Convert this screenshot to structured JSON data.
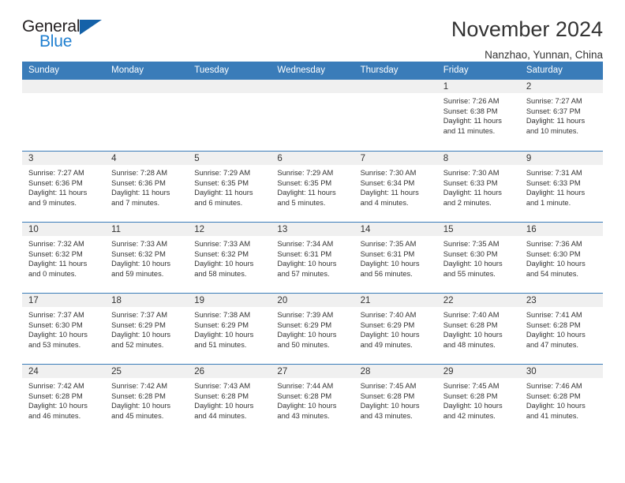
{
  "brand": {
    "name_part1": "General",
    "name_part2": "Blue",
    "triangle_color": "#1461a8",
    "blue_text_color": "#1f7fd0"
  },
  "header": {
    "title": "November 2024",
    "subtitle": "Nanzhao, Yunnan, China"
  },
  "theme": {
    "header_blue": "#3a7cb9",
    "daynum_band": "#f0f0f0",
    "text": "#333333"
  },
  "weekday_headers": [
    "Sunday",
    "Monday",
    "Tuesday",
    "Wednesday",
    "Thursday",
    "Friday",
    "Saturday"
  ],
  "weeks": [
    [
      {
        "day": "",
        "empty": true,
        "sunrise": "",
        "sunset": "",
        "daylight_line1": "",
        "daylight_line2": ""
      },
      {
        "day": "",
        "empty": true,
        "sunrise": "",
        "sunset": "",
        "daylight_line1": "",
        "daylight_line2": ""
      },
      {
        "day": "",
        "empty": true,
        "sunrise": "",
        "sunset": "",
        "daylight_line1": "",
        "daylight_line2": ""
      },
      {
        "day": "",
        "empty": true,
        "sunrise": "",
        "sunset": "",
        "daylight_line1": "",
        "daylight_line2": ""
      },
      {
        "day": "",
        "empty": true,
        "sunrise": "",
        "sunset": "",
        "daylight_line1": "",
        "daylight_line2": ""
      },
      {
        "day": "1",
        "empty": false,
        "sunrise": "Sunrise: 7:26 AM",
        "sunset": "Sunset: 6:38 PM",
        "daylight_line1": "Daylight: 11 hours",
        "daylight_line2": "and 11 minutes."
      },
      {
        "day": "2",
        "empty": false,
        "sunrise": "Sunrise: 7:27 AM",
        "sunset": "Sunset: 6:37 PM",
        "daylight_line1": "Daylight: 11 hours",
        "daylight_line2": "and 10 minutes."
      }
    ],
    [
      {
        "day": "3",
        "empty": false,
        "sunrise": "Sunrise: 7:27 AM",
        "sunset": "Sunset: 6:36 PM",
        "daylight_line1": "Daylight: 11 hours",
        "daylight_line2": "and 9 minutes."
      },
      {
        "day": "4",
        "empty": false,
        "sunrise": "Sunrise: 7:28 AM",
        "sunset": "Sunset: 6:36 PM",
        "daylight_line1": "Daylight: 11 hours",
        "daylight_line2": "and 7 minutes."
      },
      {
        "day": "5",
        "empty": false,
        "sunrise": "Sunrise: 7:29 AM",
        "sunset": "Sunset: 6:35 PM",
        "daylight_line1": "Daylight: 11 hours",
        "daylight_line2": "and 6 minutes."
      },
      {
        "day": "6",
        "empty": false,
        "sunrise": "Sunrise: 7:29 AM",
        "sunset": "Sunset: 6:35 PM",
        "daylight_line1": "Daylight: 11 hours",
        "daylight_line2": "and 5 minutes."
      },
      {
        "day": "7",
        "empty": false,
        "sunrise": "Sunrise: 7:30 AM",
        "sunset": "Sunset: 6:34 PM",
        "daylight_line1": "Daylight: 11 hours",
        "daylight_line2": "and 4 minutes."
      },
      {
        "day": "8",
        "empty": false,
        "sunrise": "Sunrise: 7:30 AM",
        "sunset": "Sunset: 6:33 PM",
        "daylight_line1": "Daylight: 11 hours",
        "daylight_line2": "and 2 minutes."
      },
      {
        "day": "9",
        "empty": false,
        "sunrise": "Sunrise: 7:31 AM",
        "sunset": "Sunset: 6:33 PM",
        "daylight_line1": "Daylight: 11 hours",
        "daylight_line2": "and 1 minute."
      }
    ],
    [
      {
        "day": "10",
        "empty": false,
        "sunrise": "Sunrise: 7:32 AM",
        "sunset": "Sunset: 6:32 PM",
        "daylight_line1": "Daylight: 11 hours",
        "daylight_line2": "and 0 minutes."
      },
      {
        "day": "11",
        "empty": false,
        "sunrise": "Sunrise: 7:33 AM",
        "sunset": "Sunset: 6:32 PM",
        "daylight_line1": "Daylight: 10 hours",
        "daylight_line2": "and 59 minutes."
      },
      {
        "day": "12",
        "empty": false,
        "sunrise": "Sunrise: 7:33 AM",
        "sunset": "Sunset: 6:32 PM",
        "daylight_line1": "Daylight: 10 hours",
        "daylight_line2": "and 58 minutes."
      },
      {
        "day": "13",
        "empty": false,
        "sunrise": "Sunrise: 7:34 AM",
        "sunset": "Sunset: 6:31 PM",
        "daylight_line1": "Daylight: 10 hours",
        "daylight_line2": "and 57 minutes."
      },
      {
        "day": "14",
        "empty": false,
        "sunrise": "Sunrise: 7:35 AM",
        "sunset": "Sunset: 6:31 PM",
        "daylight_line1": "Daylight: 10 hours",
        "daylight_line2": "and 56 minutes."
      },
      {
        "day": "15",
        "empty": false,
        "sunrise": "Sunrise: 7:35 AM",
        "sunset": "Sunset: 6:30 PM",
        "daylight_line1": "Daylight: 10 hours",
        "daylight_line2": "and 55 minutes."
      },
      {
        "day": "16",
        "empty": false,
        "sunrise": "Sunrise: 7:36 AM",
        "sunset": "Sunset: 6:30 PM",
        "daylight_line1": "Daylight: 10 hours",
        "daylight_line2": "and 54 minutes."
      }
    ],
    [
      {
        "day": "17",
        "empty": false,
        "sunrise": "Sunrise: 7:37 AM",
        "sunset": "Sunset: 6:30 PM",
        "daylight_line1": "Daylight: 10 hours",
        "daylight_line2": "and 53 minutes."
      },
      {
        "day": "18",
        "empty": false,
        "sunrise": "Sunrise: 7:37 AM",
        "sunset": "Sunset: 6:29 PM",
        "daylight_line1": "Daylight: 10 hours",
        "daylight_line2": "and 52 minutes."
      },
      {
        "day": "19",
        "empty": false,
        "sunrise": "Sunrise: 7:38 AM",
        "sunset": "Sunset: 6:29 PM",
        "daylight_line1": "Daylight: 10 hours",
        "daylight_line2": "and 51 minutes."
      },
      {
        "day": "20",
        "empty": false,
        "sunrise": "Sunrise: 7:39 AM",
        "sunset": "Sunset: 6:29 PM",
        "daylight_line1": "Daylight: 10 hours",
        "daylight_line2": "and 50 minutes."
      },
      {
        "day": "21",
        "empty": false,
        "sunrise": "Sunrise: 7:40 AM",
        "sunset": "Sunset: 6:29 PM",
        "daylight_line1": "Daylight: 10 hours",
        "daylight_line2": "and 49 minutes."
      },
      {
        "day": "22",
        "empty": false,
        "sunrise": "Sunrise: 7:40 AM",
        "sunset": "Sunset: 6:28 PM",
        "daylight_line1": "Daylight: 10 hours",
        "daylight_line2": "and 48 minutes."
      },
      {
        "day": "23",
        "empty": false,
        "sunrise": "Sunrise: 7:41 AM",
        "sunset": "Sunset: 6:28 PM",
        "daylight_line1": "Daylight: 10 hours",
        "daylight_line2": "and 47 minutes."
      }
    ],
    [
      {
        "day": "24",
        "empty": false,
        "sunrise": "Sunrise: 7:42 AM",
        "sunset": "Sunset: 6:28 PM",
        "daylight_line1": "Daylight: 10 hours",
        "daylight_line2": "and 46 minutes."
      },
      {
        "day": "25",
        "empty": false,
        "sunrise": "Sunrise: 7:42 AM",
        "sunset": "Sunset: 6:28 PM",
        "daylight_line1": "Daylight: 10 hours",
        "daylight_line2": "and 45 minutes."
      },
      {
        "day": "26",
        "empty": false,
        "sunrise": "Sunrise: 7:43 AM",
        "sunset": "Sunset: 6:28 PM",
        "daylight_line1": "Daylight: 10 hours",
        "daylight_line2": "and 44 minutes."
      },
      {
        "day": "27",
        "empty": false,
        "sunrise": "Sunrise: 7:44 AM",
        "sunset": "Sunset: 6:28 PM",
        "daylight_line1": "Daylight: 10 hours",
        "daylight_line2": "and 43 minutes."
      },
      {
        "day": "28",
        "empty": false,
        "sunrise": "Sunrise: 7:45 AM",
        "sunset": "Sunset: 6:28 PM",
        "daylight_line1": "Daylight: 10 hours",
        "daylight_line2": "and 43 minutes."
      },
      {
        "day": "29",
        "empty": false,
        "sunrise": "Sunrise: 7:45 AM",
        "sunset": "Sunset: 6:28 PM",
        "daylight_line1": "Daylight: 10 hours",
        "daylight_line2": "and 42 minutes."
      },
      {
        "day": "30",
        "empty": false,
        "sunrise": "Sunrise: 7:46 AM",
        "sunset": "Sunset: 6:28 PM",
        "daylight_line1": "Daylight: 10 hours",
        "daylight_line2": "and 41 minutes."
      }
    ]
  ]
}
